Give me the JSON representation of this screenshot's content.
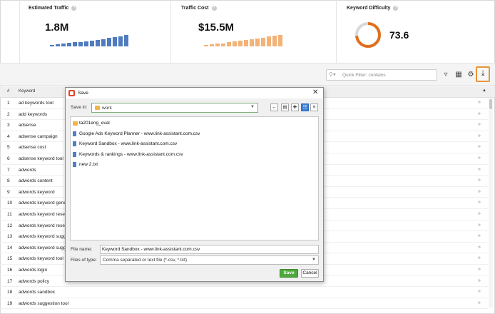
{
  "metrics": {
    "traffic": {
      "title": "Estimated Traffic",
      "value": "1.8M",
      "color": "#4f7bbf",
      "bars": [
        0.12,
        0.15,
        0.2,
        0.25,
        0.3,
        0.32,
        0.36,
        0.42,
        0.46,
        0.52,
        0.6,
        0.66,
        0.72,
        0.78
      ]
    },
    "cost": {
      "title": "Traffic Cost",
      "value": "$15.5M",
      "color": "#f2b278",
      "bars": [
        0.1,
        0.14,
        0.18,
        0.22,
        0.3,
        0.34,
        0.38,
        0.44,
        0.5,
        0.56,
        0.62,
        0.68,
        0.74,
        0.8
      ]
    },
    "difficulty": {
      "title": "Keyword Difficulty",
      "value": "73.6",
      "fraction": 0.736,
      "color": "#e06f1c",
      "track_color": "#d9d9d9"
    }
  },
  "toolbar": {
    "filter_placeholder": "Quick Filter: contains",
    "accent": "#e8953a"
  },
  "table": {
    "headers": {
      "num": "#",
      "keyword": "Keyword"
    },
    "rows": [
      {
        "num": "1",
        "keyword": "ad keywords tool"
      },
      {
        "num": "2",
        "keyword": "add keywords"
      },
      {
        "num": "3",
        "keyword": "adsense"
      },
      {
        "num": "4",
        "keyword": "adsense campaign"
      },
      {
        "num": "5",
        "keyword": "adsense cost"
      },
      {
        "num": "6",
        "keyword": "adsense keyword tool"
      },
      {
        "num": "7",
        "keyword": "adwords"
      },
      {
        "num": "8",
        "keyword": "adwords content"
      },
      {
        "num": "9",
        "keyword": "adwords keyword"
      },
      {
        "num": "10",
        "keyword": "adwords keyword gene"
      },
      {
        "num": "11",
        "keyword": "adwords keyword resea"
      },
      {
        "num": "12",
        "keyword": "adwords keyword resea"
      },
      {
        "num": "13",
        "keyword": "adwords keyword sugge"
      },
      {
        "num": "14",
        "keyword": "adwords keyword sugg"
      },
      {
        "num": "15",
        "keyword": "adwords keyword tool"
      },
      {
        "num": "16",
        "keyword": "adwords login"
      },
      {
        "num": "17",
        "keyword": "adwords policy"
      },
      {
        "num": "18",
        "keyword": "adwords sandbox"
      },
      {
        "num": "19",
        "keyword": "adwords suggestion tool"
      }
    ]
  },
  "dialog": {
    "title": "Save",
    "save_in_label": "Save in:",
    "save_in_value": "work",
    "files": [
      {
        "name": "ta201eng_eval",
        "type": "folder"
      },
      {
        "name": "Google Ads Keyword Planner - www.link-assistant.com.csv",
        "type": "file"
      },
      {
        "name": "Keyword Sandbox - www.link-assistant.com.csv",
        "type": "file"
      },
      {
        "name": "Keywords & rankings - www.link-assistant.com.csv",
        "type": "file"
      },
      {
        "name": "new 2.txt",
        "type": "file"
      }
    ],
    "file_name_label": "File name:",
    "file_name_value": "Keyword Sandbox - www.link-assistant.com.csv",
    "file_type_label": "Files of type:",
    "file_type_value": "Comma separated or text file (*.csv, *.txt)",
    "save_label": "Save",
    "cancel_label": "Cancel"
  }
}
